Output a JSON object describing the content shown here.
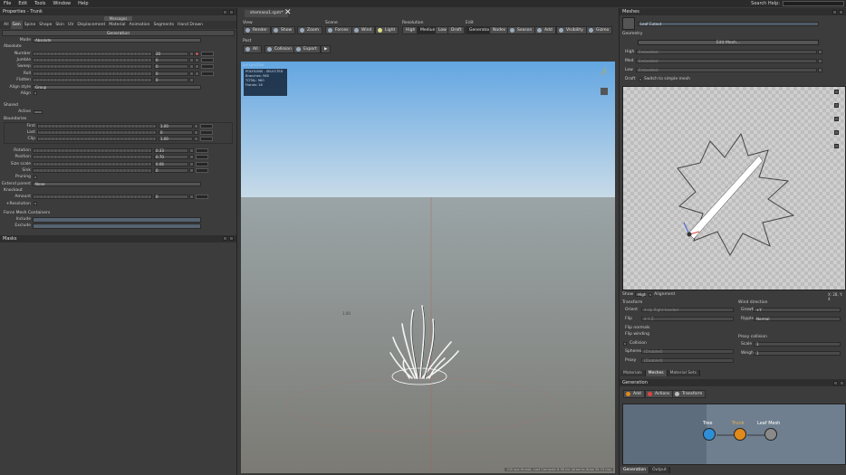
{
  "menubar": {
    "items": [
      "File",
      "Edit",
      "Tools",
      "Window",
      "Help"
    ],
    "search_label": "Search Help:",
    "search_value": ""
  },
  "left_panel": {
    "title": "Properties - Trunk",
    "messages_tab": "Messages",
    "tabs": [
      "All",
      "Gen",
      "Spine",
      "Shape",
      "Skin",
      "UV",
      "Displacement",
      "Material",
      "Animation",
      "Segments",
      "Hand Drawn"
    ],
    "active_tab": "Gen",
    "section": "Generation",
    "mode_label": "Mode",
    "mode_value": "Absolute",
    "absolute_group": "Absolute",
    "absolute_rows": [
      {
        "label": "Number",
        "value": "20"
      },
      {
        "label": "Jumble",
        "value": "0"
      },
      {
        "label": "Sweep",
        "value": "0"
      },
      {
        "label": "Roll",
        "value": "0"
      },
      {
        "label": "Flatten",
        "value": "0"
      }
    ],
    "align_style_label": "Align style",
    "align_style_value": "Group",
    "align_label": "Align",
    "shared_group": "Shared",
    "active_label": "Active",
    "boundaries_group": "Boundaries",
    "boundary_rows": [
      {
        "label": "First",
        "value": "1.00"
      },
      {
        "label": "Last",
        "value": "0"
      },
      {
        "label": "Clip",
        "value": "1.00"
      }
    ],
    "shared_rows": [
      {
        "label": "Rotation",
        "value": "0.33"
      },
      {
        "label": "Position",
        "value": "0.70"
      },
      {
        "label": "Size scale",
        "value": "0.06"
      },
      {
        "label": "Sink",
        "value": "0"
      }
    ],
    "pruning_label": "Pruning",
    "extend_parent_label": "Extend parent",
    "extend_parent_value": "None",
    "knockout_group": "Knockout",
    "amount_label": "Amount",
    "amount_value": "0",
    "resolution_label": "+Resolution",
    "force_group": "Force Mesh Containers",
    "include_label": "Include",
    "exclude_label": "Exclude",
    "masks_title": "Masks"
  },
  "center": {
    "doc_tab": "shemaso1.spm*",
    "view_label": "View",
    "view_buttons": [
      "Render",
      "Show",
      "Zoom"
    ],
    "scene_label": "Scene",
    "scene_buttons": [
      "Forces",
      "Wind",
      "Light"
    ],
    "resolution_label": "Resolution",
    "resolution_buttons": [
      "High",
      "Medium",
      "Low",
      "Draft"
    ],
    "resolution_selected": "Medium",
    "edit_label": "Edit",
    "edit_buttons": [
      "Generators",
      "Nodes",
      "Season",
      "Add",
      "Visibility",
      "Gizmo"
    ],
    "edit_selected": "Generators",
    "post_label": "Post",
    "post_buttons": [
      "All",
      "Collision",
      "Export",
      "▶"
    ],
    "viewport_label": "perspective",
    "overlay": {
      "title": "POLYGONS - SELECTED",
      "line1": "Branches: 960",
      "line2": "TOTAL: 960",
      "line3": "Fronds: 18"
    },
    "grid_marker": "1.00",
    "status": "100 ops thread, Last Compute 8.36 ms (draw to draw 35.74 ms)"
  },
  "right_panel": {
    "title": "Meshes",
    "mesh_name": "Leaf Cutout",
    "geometry_label": "Geometry",
    "edit_mesh_button": "Edit Mesh...",
    "lod_rows": [
      {
        "label": "High",
        "value": "Embedded"
      },
      {
        "label": "Med",
        "value": "Embedded"
      },
      {
        "label": "Low",
        "value": "Embedded"
      }
    ],
    "draft_label": "Draft",
    "draft_option": "Switch to simple mesh",
    "show_label": "Show",
    "show_value": "High",
    "alignment_label": "Alignment",
    "scale_readout": "X: 28, Y: 4",
    "transform_label": "Transform",
    "orient_label": "Orient",
    "orient_value": "X-Up Right-handed",
    "flip_label": "Flip",
    "flip_value": "X Y Z",
    "flip_normals_label": "Flip normals",
    "flip_winding_label": "Flip winding",
    "collision_label": "Collision",
    "spheres_label": "Spheres",
    "spheres_value": "(Disabled)",
    "proxy_label": "Proxy",
    "proxy_value": "(Disabled)",
    "wind_direction_label": "Wind direction",
    "growth_label": "Growth",
    "growth_value": "+Y",
    "ripple_label": "Ripple",
    "ripple_value": "Normal",
    "proxy_collision_label": "Proxy collision",
    "scale_label": "Scale",
    "scale_value": "1",
    "weight_label": "Weight",
    "weight_value": "1",
    "mid_tabs": [
      "Materials",
      "Meshes",
      "Material Sets"
    ],
    "mid_tab_active": "Meshes",
    "generation_title": "Generation",
    "gen_buttons": [
      "Add",
      "Actions",
      "Transform"
    ],
    "nodes": [
      {
        "label": "Tree",
        "color": "#2f8fd6"
      },
      {
        "label": "Trunk",
        "color": "#e08a1c"
      },
      {
        "label": "Leaf Mesh",
        "color": "#8a8a8a"
      }
    ],
    "bottom_tabs": [
      "Generation",
      "Output"
    ],
    "bottom_tab_active": "Generation"
  }
}
